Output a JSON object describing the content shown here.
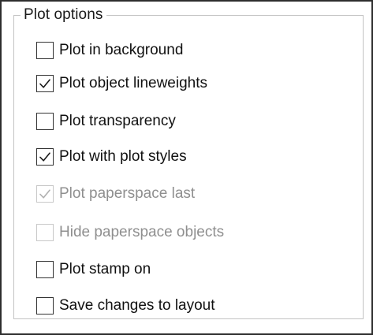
{
  "group": {
    "title": "Plot options"
  },
  "options": [
    {
      "label": "Plot in background",
      "checked": false,
      "enabled": true
    },
    {
      "label": "Plot object lineweights",
      "checked": true,
      "enabled": true
    },
    {
      "label": "Plot transparency",
      "checked": false,
      "enabled": true
    },
    {
      "label": "Plot with plot styles",
      "checked": true,
      "enabled": true
    },
    {
      "label": "Plot paperspace last",
      "checked": true,
      "enabled": false
    },
    {
      "label": "Hide paperspace objects",
      "checked": false,
      "enabled": false
    },
    {
      "label": "Plot stamp on",
      "checked": false,
      "enabled": true
    },
    {
      "label": "Save changes to layout",
      "checked": false,
      "enabled": true
    }
  ],
  "colors": {
    "checkmark": "#1a1a1a",
    "checkmark_disabled": "#b0b0b0"
  },
  "icons": {
    "check": "checkmark-icon"
  }
}
